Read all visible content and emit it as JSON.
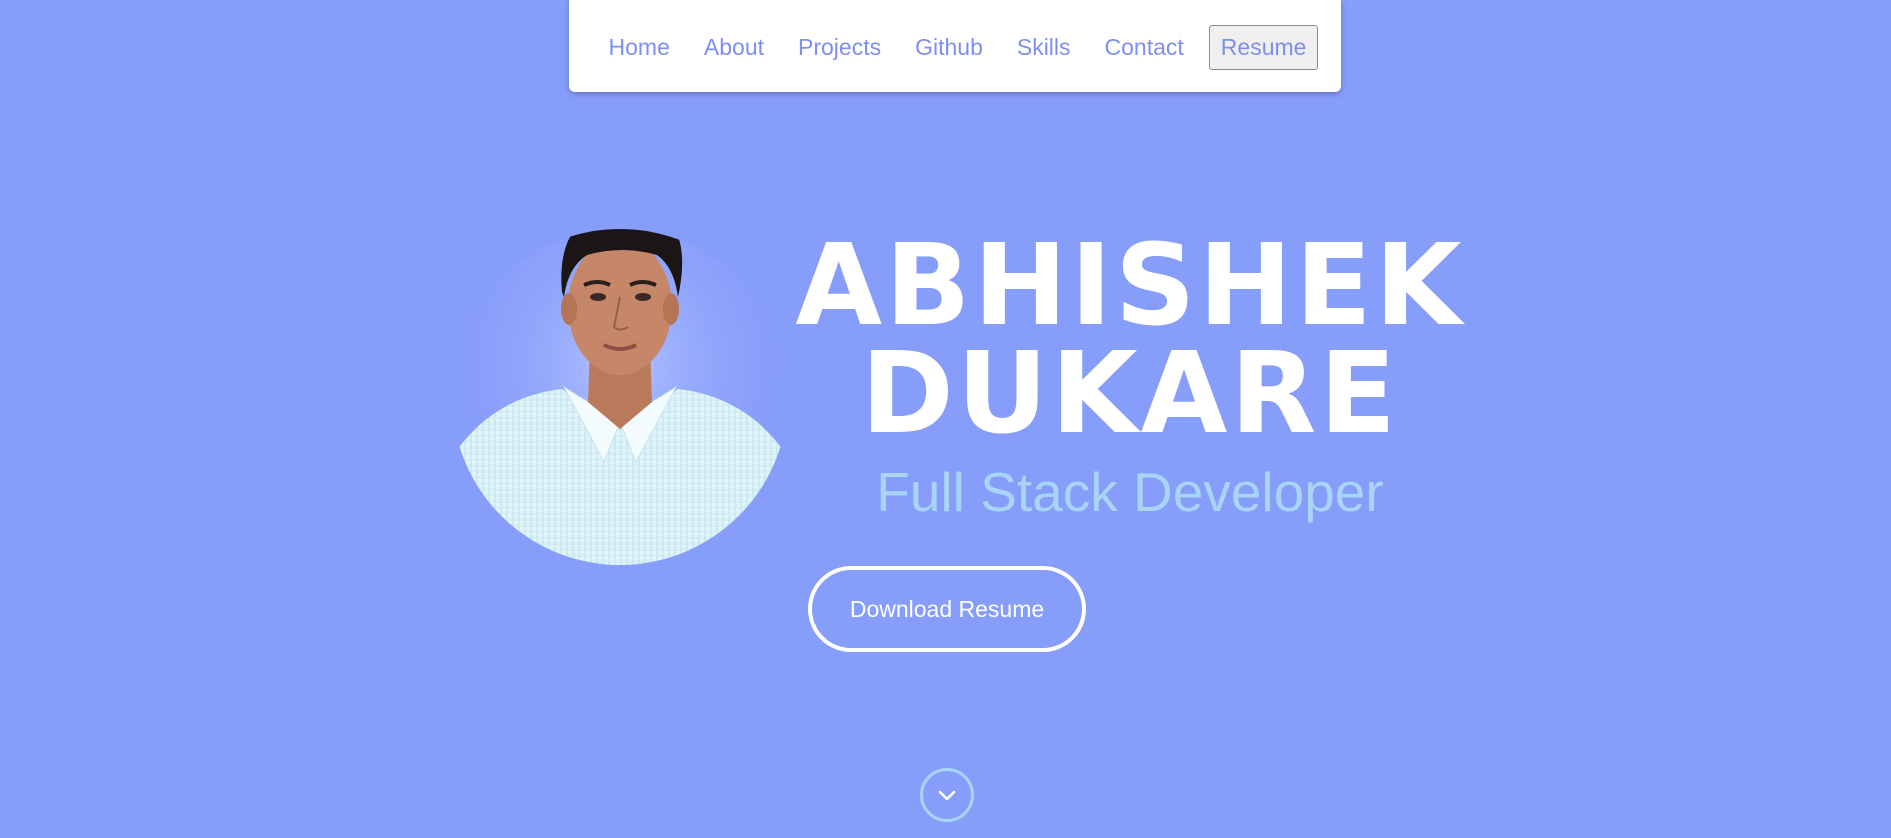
{
  "nav": {
    "items": [
      {
        "label": "Home"
      },
      {
        "label": "About"
      },
      {
        "label": "Projects"
      },
      {
        "label": "Github"
      },
      {
        "label": "Skills"
      },
      {
        "label": "Contact"
      }
    ],
    "resume_label": "Resume"
  },
  "hero": {
    "first_name": "ABHISHEK",
    "last_name": "DUKARE",
    "subtitle": "Full Stack Developer",
    "download_label": "Download Resume"
  },
  "colors": {
    "background": "#869dfa",
    "nav_link": "#7e8fee",
    "subtitle": "#a8d4f7",
    "button_border": "#ffffff"
  },
  "icons": {
    "scroll": "chevron-down-icon",
    "avatar": "profile-photo"
  }
}
